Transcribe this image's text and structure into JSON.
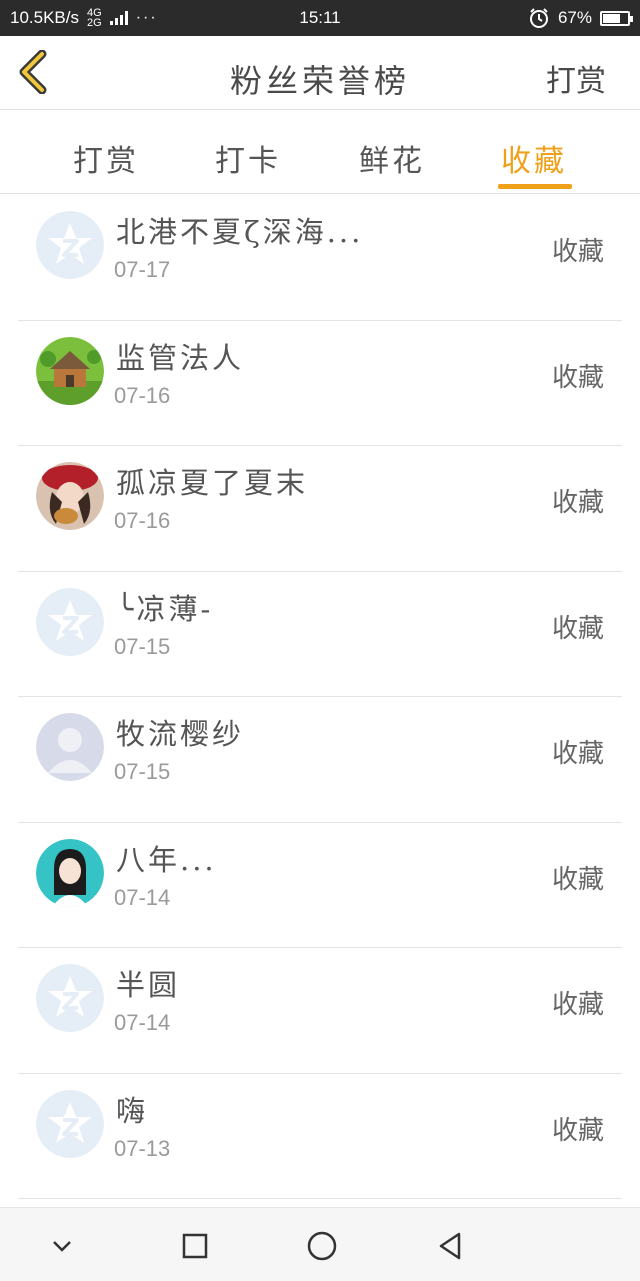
{
  "status_bar": {
    "net_speed": "10.5KB/s",
    "network_labels": [
      "4G",
      "2G"
    ],
    "more": "···",
    "time": "15:11",
    "battery_percent": "67%",
    "battery_level": 0.67,
    "icons": [
      "signal-icon",
      "alarm-icon",
      "battery-icon"
    ]
  },
  "header": {
    "title": "粉丝荣誉榜",
    "action": "打赏",
    "back_icon": "chevron-left-icon"
  },
  "tabs": [
    {
      "label": "打赏",
      "active": false
    },
    {
      "label": "打卡",
      "active": false
    },
    {
      "label": "鲜花",
      "active": false
    },
    {
      "label": "收藏",
      "active": true
    }
  ],
  "accent_color": "#f0a11c",
  "items": [
    {
      "name": "北港不夏ζ深海...",
      "date": "07-17",
      "action": "收藏",
      "avatar": "default-star"
    },
    {
      "name": "监管法人",
      "date": "07-16",
      "action": "收藏",
      "avatar": "cottage"
    },
    {
      "name": "孤凉夏了夏末",
      "date": "07-16",
      "action": "收藏",
      "avatar": "girl-red-hat"
    },
    {
      "name": "╰凉薄-",
      "date": "07-15",
      "action": "收藏",
      "avatar": "default-star"
    },
    {
      "name": "牧流樱纱",
      "date": "07-15",
      "action": "收藏",
      "avatar": "default-person"
    },
    {
      "name": "八年...",
      "date": "07-14",
      "action": "收藏",
      "avatar": "girl-teal"
    },
    {
      "name": "半圆",
      "date": "07-14",
      "action": "收藏",
      "avatar": "default-star"
    },
    {
      "name": "嗨",
      "date": "07-13",
      "action": "收藏",
      "avatar": "default-star"
    }
  ],
  "nav_bar": [
    "chevron-down-icon",
    "square-icon",
    "circle-icon",
    "triangle-back-icon"
  ]
}
